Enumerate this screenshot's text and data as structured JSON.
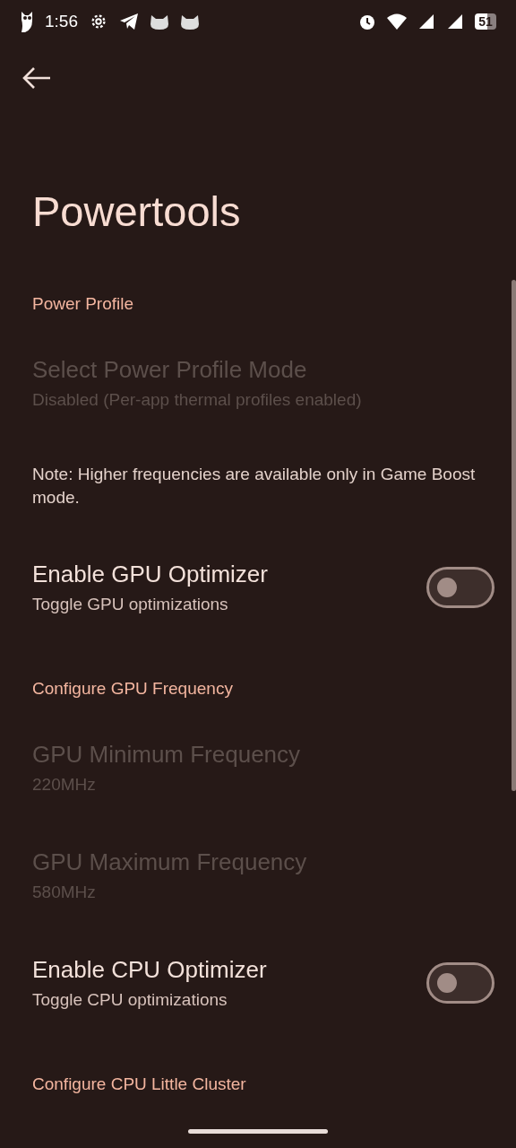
{
  "status_bar": {
    "time": "1:56",
    "battery": "51"
  },
  "title": "Powertools",
  "items": [
    {
      "kind": "header",
      "title": "Power Profile"
    },
    {
      "kind": "preference",
      "title": "Select Power Profile Mode",
      "summary": "Disabled (Per-app thermal profiles enabled)",
      "disabled": true
    },
    {
      "kind": "note",
      "title": "Note: Higher frequencies are available only in Game Boost mode."
    },
    {
      "kind": "switch",
      "title": "Enable GPU Optimizer",
      "summary": "Toggle GPU optimizations",
      "on": false
    },
    {
      "kind": "header",
      "title": "Configure GPU Frequency"
    },
    {
      "kind": "preference",
      "title": "GPU Minimum Frequency",
      "summary": "220MHz",
      "disabled": true
    },
    {
      "kind": "preference",
      "title": "GPU Maximum Frequency",
      "summary": "580MHz",
      "disabled": true
    },
    {
      "kind": "switch",
      "title": "Enable CPU Optimizer",
      "summary": "Toggle CPU optimizations",
      "on": false
    },
    {
      "kind": "header",
      "title": "Configure CPU Little Cluster"
    }
  ]
}
